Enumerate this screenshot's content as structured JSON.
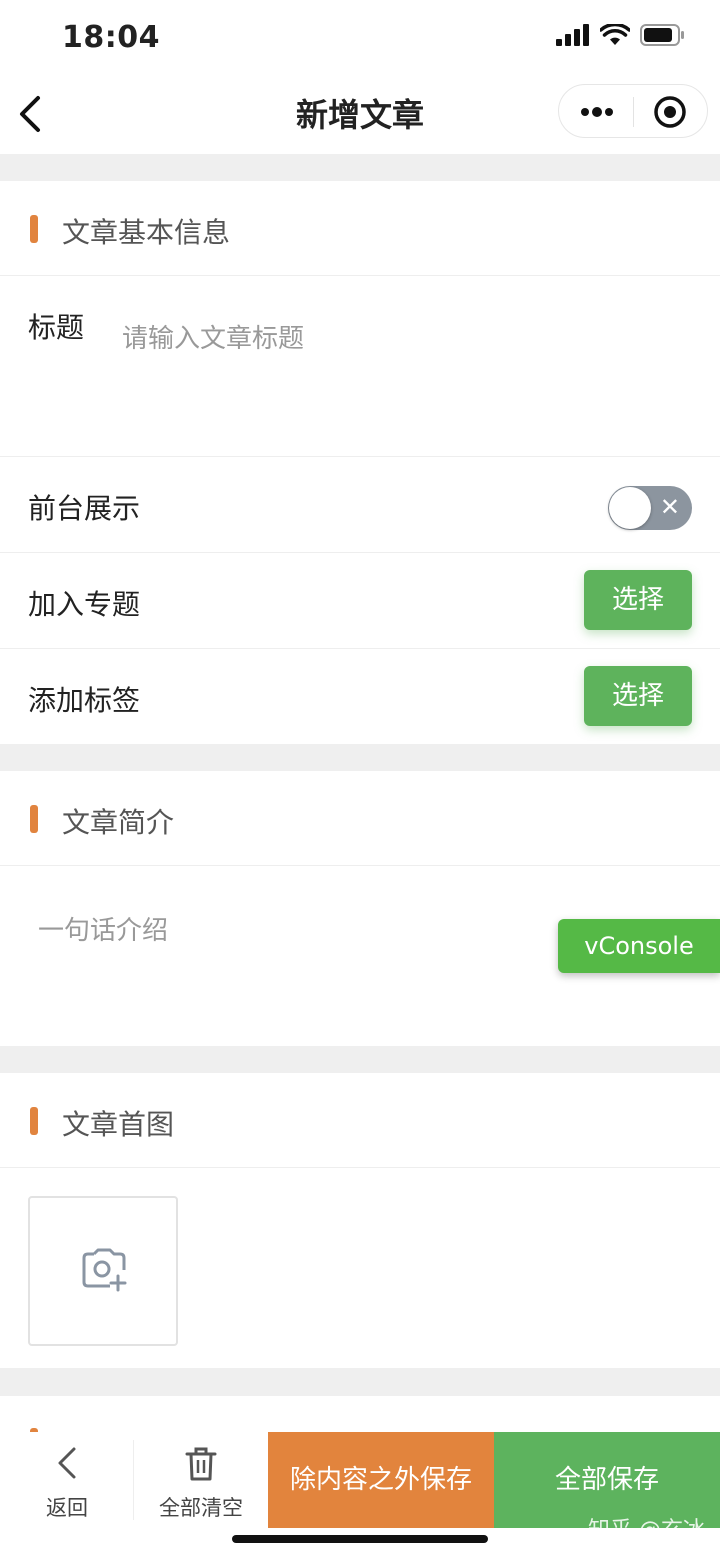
{
  "status_bar": {
    "time": "18:04"
  },
  "nav": {
    "title": "新增文章"
  },
  "basic_info": {
    "section_title": "文章基本信息",
    "title_label": "标题",
    "title_placeholder": "请输入文章标题",
    "title_value": "",
    "frontend_display_label": "前台展示",
    "frontend_display_on": false,
    "topic_label": "加入专题",
    "topic_button": "选择",
    "tag_label": "添加标签",
    "tag_button": "选择"
  },
  "intro": {
    "section_title": "文章简介",
    "placeholder": "一句话介绍",
    "value": ""
  },
  "vconsole": {
    "label": "vConsole"
  },
  "cover": {
    "section_title": "文章首图"
  },
  "bottom_bar": {
    "back_label": "返回",
    "clear_label": "全部清空",
    "save_except_content": "除内容之外保存",
    "save_all": "全部保存"
  },
  "watermark": "知乎 @玄冰",
  "colors": {
    "accent_orange": "#e2843d",
    "accent_green": "#5db35e",
    "vconsole_green": "#55b946"
  }
}
